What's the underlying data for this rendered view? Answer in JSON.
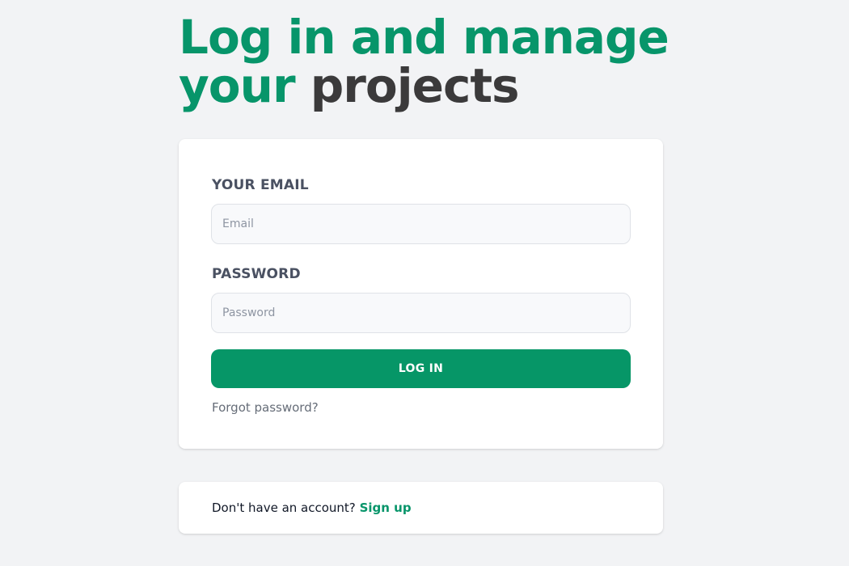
{
  "headline": {
    "line1": "Log in and manage",
    "line2_accent": "your",
    "line2_dark": "projects"
  },
  "login_form": {
    "email_label": "YOUR EMAIL",
    "email_placeholder": "Email",
    "email_value": "",
    "password_label": "PASSWORD",
    "password_placeholder": "Password",
    "password_value": "",
    "submit_label": "LOG IN",
    "forgot_label": "Forgot password?"
  },
  "signup": {
    "prompt": "Don't have an account?",
    "link_label": "Sign up"
  },
  "colors": {
    "accent": "#07956a",
    "button": "#069667",
    "headline_dark": "#3b3a3b",
    "page_background": "#f2f3f5",
    "label_text": "#4a5162"
  }
}
